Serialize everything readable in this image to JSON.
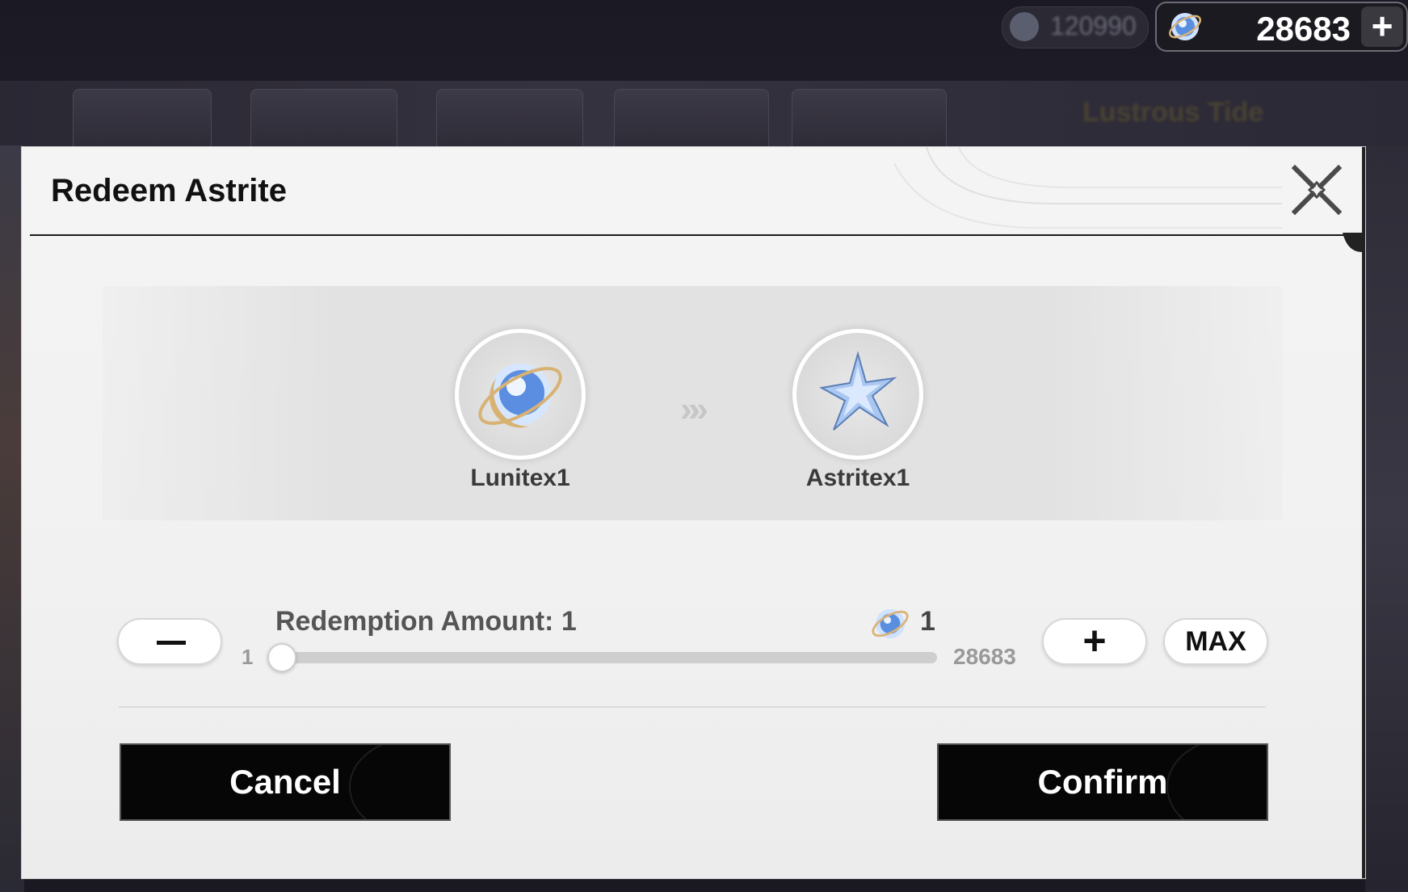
{
  "hud": {
    "currency_value": "28683",
    "currency_plus": "+",
    "bg_title": "Lustrous Tide",
    "bg_pill_text": "120990"
  },
  "dialog": {
    "title": "Redeem Astrite",
    "from_item_label": "Lunitex1",
    "to_item_label": "Astritex1",
    "arrows": "»»",
    "amount_label": "Redemption Amount: 1",
    "cost_value": "1",
    "slider": {
      "min_label": "1",
      "max_label": "28683",
      "value": 1,
      "min": 1,
      "max": 28683
    },
    "minus_label": "",
    "plus_label": "+",
    "max_label": "MAX",
    "cancel_label": "Cancel",
    "confirm_label": "Confirm"
  },
  "icons": {
    "close": "close-icon",
    "lunite": "lunite-icon",
    "astrite": "astrite-icon"
  }
}
